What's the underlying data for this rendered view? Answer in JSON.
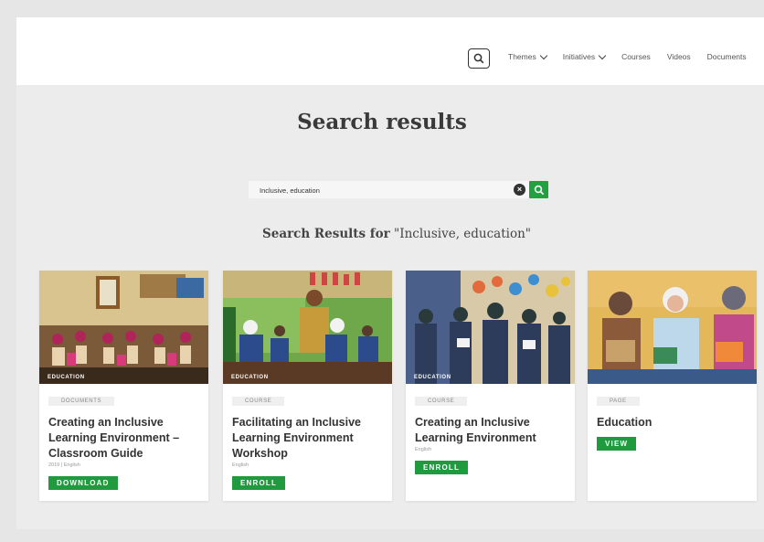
{
  "header": {
    "nav": [
      {
        "label": "Themes",
        "dropdown": true
      },
      {
        "label": "Initiatives",
        "dropdown": true
      },
      {
        "label": "Courses",
        "dropdown": false
      },
      {
        "label": "Videos",
        "dropdown": false
      },
      {
        "label": "Documents",
        "dropdown": false
      }
    ]
  },
  "main": {
    "title": "Search results",
    "search": {
      "value": "Inclusive, education",
      "placeholder": ""
    },
    "results_prefix": "Search Results for",
    "results_query": "\"Inclusive, education\""
  },
  "cards": [
    {
      "image_label": "EDUCATION",
      "type": "DOCUMENTS",
      "title": "Creating an Inclusive Learning Environment – Classroom Guide",
      "meta": "2019 | English",
      "action": "DOWNLOAD"
    },
    {
      "image_label": "EDUCATION",
      "type": "COURSE",
      "title": "Facilitating an Inclusive Learning Environment Workshop",
      "meta": "English",
      "action": "ENROLL"
    },
    {
      "image_label": "EDUCATION",
      "type": "COURSE",
      "title": "Creating an Inclusive Learning Environment",
      "meta": "English",
      "action": "ENROLL"
    },
    {
      "image_label": "",
      "type": "PAGE",
      "title": "Education",
      "meta": "",
      "action": "VIEW"
    }
  ],
  "colors": {
    "accent": "#1f9a3e",
    "text": "#333333",
    "background": "#ececec"
  }
}
